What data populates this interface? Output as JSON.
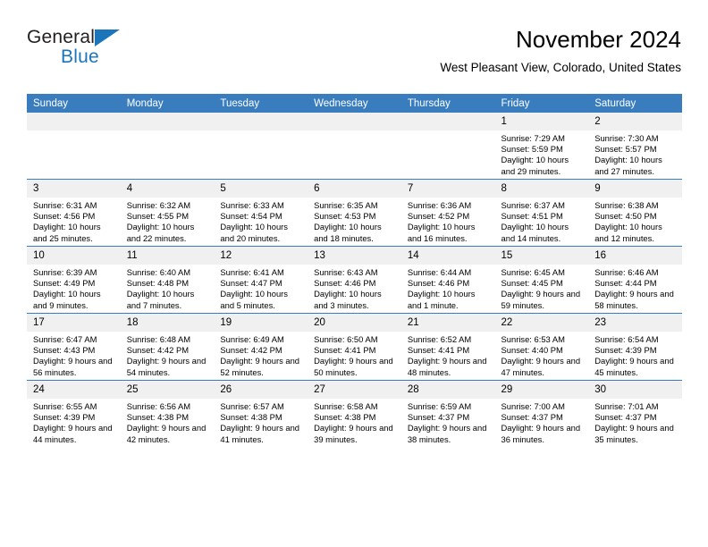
{
  "brand": {
    "name_part1": "General",
    "name_part2": "Blue",
    "triangle_color": "#1b75bb",
    "text_color": "#231f20"
  },
  "header": {
    "title": "November 2024",
    "subtitle": "West Pleasant View, Colorado, United States"
  },
  "theme": {
    "header_blue": "#3a7dbf",
    "daynum_bg": "#f0f0f0",
    "text": "#000000"
  },
  "weekdays": [
    "Sunday",
    "Monday",
    "Tuesday",
    "Wednesday",
    "Thursday",
    "Friday",
    "Saturday"
  ],
  "labels": {
    "sunrise_prefix": "Sunrise:",
    "sunset_prefix": "Sunset:",
    "daylight_prefix": "Daylight:"
  },
  "weeks": [
    [
      {
        "day": "",
        "blank": true,
        "sunrise": "",
        "sunset": "",
        "daylight": ""
      },
      {
        "day": "",
        "blank": true,
        "sunrise": "",
        "sunset": "",
        "daylight": ""
      },
      {
        "day": "",
        "blank": true,
        "sunrise": "",
        "sunset": "",
        "daylight": ""
      },
      {
        "day": "",
        "blank": true,
        "sunrise": "",
        "sunset": "",
        "daylight": ""
      },
      {
        "day": "",
        "blank": true,
        "sunrise": "",
        "sunset": "",
        "daylight": ""
      },
      {
        "day": "1",
        "blank": false,
        "sunrise": "Sunrise: 7:29 AM",
        "sunset": "Sunset: 5:59 PM",
        "daylight": "Daylight: 10 hours and 29 minutes."
      },
      {
        "day": "2",
        "blank": false,
        "sunrise": "Sunrise: 7:30 AM",
        "sunset": "Sunset: 5:57 PM",
        "daylight": "Daylight: 10 hours and 27 minutes."
      }
    ],
    [
      {
        "day": "3",
        "blank": false,
        "sunrise": "Sunrise: 6:31 AM",
        "sunset": "Sunset: 4:56 PM",
        "daylight": "Daylight: 10 hours and 25 minutes."
      },
      {
        "day": "4",
        "blank": false,
        "sunrise": "Sunrise: 6:32 AM",
        "sunset": "Sunset: 4:55 PM",
        "daylight": "Daylight: 10 hours and 22 minutes."
      },
      {
        "day": "5",
        "blank": false,
        "sunrise": "Sunrise: 6:33 AM",
        "sunset": "Sunset: 4:54 PM",
        "daylight": "Daylight: 10 hours and 20 minutes."
      },
      {
        "day": "6",
        "blank": false,
        "sunrise": "Sunrise: 6:35 AM",
        "sunset": "Sunset: 4:53 PM",
        "daylight": "Daylight: 10 hours and 18 minutes."
      },
      {
        "day": "7",
        "blank": false,
        "sunrise": "Sunrise: 6:36 AM",
        "sunset": "Sunset: 4:52 PM",
        "daylight": "Daylight: 10 hours and 16 minutes."
      },
      {
        "day": "8",
        "blank": false,
        "sunrise": "Sunrise: 6:37 AM",
        "sunset": "Sunset: 4:51 PM",
        "daylight": "Daylight: 10 hours and 14 minutes."
      },
      {
        "day": "9",
        "blank": false,
        "sunrise": "Sunrise: 6:38 AM",
        "sunset": "Sunset: 4:50 PM",
        "daylight": "Daylight: 10 hours and 12 minutes."
      }
    ],
    [
      {
        "day": "10",
        "blank": false,
        "sunrise": "Sunrise: 6:39 AM",
        "sunset": "Sunset: 4:49 PM",
        "daylight": "Daylight: 10 hours and 9 minutes."
      },
      {
        "day": "11",
        "blank": false,
        "sunrise": "Sunrise: 6:40 AM",
        "sunset": "Sunset: 4:48 PM",
        "daylight": "Daylight: 10 hours and 7 minutes."
      },
      {
        "day": "12",
        "blank": false,
        "sunrise": "Sunrise: 6:41 AM",
        "sunset": "Sunset: 4:47 PM",
        "daylight": "Daylight: 10 hours and 5 minutes."
      },
      {
        "day": "13",
        "blank": false,
        "sunrise": "Sunrise: 6:43 AM",
        "sunset": "Sunset: 4:46 PM",
        "daylight": "Daylight: 10 hours and 3 minutes."
      },
      {
        "day": "14",
        "blank": false,
        "sunrise": "Sunrise: 6:44 AM",
        "sunset": "Sunset: 4:46 PM",
        "daylight": "Daylight: 10 hours and 1 minute."
      },
      {
        "day": "15",
        "blank": false,
        "sunrise": "Sunrise: 6:45 AM",
        "sunset": "Sunset: 4:45 PM",
        "daylight": "Daylight: 9 hours and 59 minutes."
      },
      {
        "day": "16",
        "blank": false,
        "sunrise": "Sunrise: 6:46 AM",
        "sunset": "Sunset: 4:44 PM",
        "daylight": "Daylight: 9 hours and 58 minutes."
      }
    ],
    [
      {
        "day": "17",
        "blank": false,
        "sunrise": "Sunrise: 6:47 AM",
        "sunset": "Sunset: 4:43 PM",
        "daylight": "Daylight: 9 hours and 56 minutes."
      },
      {
        "day": "18",
        "blank": false,
        "sunrise": "Sunrise: 6:48 AM",
        "sunset": "Sunset: 4:42 PM",
        "daylight": "Daylight: 9 hours and 54 minutes."
      },
      {
        "day": "19",
        "blank": false,
        "sunrise": "Sunrise: 6:49 AM",
        "sunset": "Sunset: 4:42 PM",
        "daylight": "Daylight: 9 hours and 52 minutes."
      },
      {
        "day": "20",
        "blank": false,
        "sunrise": "Sunrise: 6:50 AM",
        "sunset": "Sunset: 4:41 PM",
        "daylight": "Daylight: 9 hours and 50 minutes."
      },
      {
        "day": "21",
        "blank": false,
        "sunrise": "Sunrise: 6:52 AM",
        "sunset": "Sunset: 4:41 PM",
        "daylight": "Daylight: 9 hours and 48 minutes."
      },
      {
        "day": "22",
        "blank": false,
        "sunrise": "Sunrise: 6:53 AM",
        "sunset": "Sunset: 4:40 PM",
        "daylight": "Daylight: 9 hours and 47 minutes."
      },
      {
        "day": "23",
        "blank": false,
        "sunrise": "Sunrise: 6:54 AM",
        "sunset": "Sunset: 4:39 PM",
        "daylight": "Daylight: 9 hours and 45 minutes."
      }
    ],
    [
      {
        "day": "24",
        "blank": false,
        "sunrise": "Sunrise: 6:55 AM",
        "sunset": "Sunset: 4:39 PM",
        "daylight": "Daylight: 9 hours and 44 minutes."
      },
      {
        "day": "25",
        "blank": false,
        "sunrise": "Sunrise: 6:56 AM",
        "sunset": "Sunset: 4:38 PM",
        "daylight": "Daylight: 9 hours and 42 minutes."
      },
      {
        "day": "26",
        "blank": false,
        "sunrise": "Sunrise: 6:57 AM",
        "sunset": "Sunset: 4:38 PM",
        "daylight": "Daylight: 9 hours and 41 minutes."
      },
      {
        "day": "27",
        "blank": false,
        "sunrise": "Sunrise: 6:58 AM",
        "sunset": "Sunset: 4:38 PM",
        "daylight": "Daylight: 9 hours and 39 minutes."
      },
      {
        "day": "28",
        "blank": false,
        "sunrise": "Sunrise: 6:59 AM",
        "sunset": "Sunset: 4:37 PM",
        "daylight": "Daylight: 9 hours and 38 minutes."
      },
      {
        "day": "29",
        "blank": false,
        "sunrise": "Sunrise: 7:00 AM",
        "sunset": "Sunset: 4:37 PM",
        "daylight": "Daylight: 9 hours and 36 minutes."
      },
      {
        "day": "30",
        "blank": false,
        "sunrise": "Sunrise: 7:01 AM",
        "sunset": "Sunset: 4:37 PM",
        "daylight": "Daylight: 9 hours and 35 minutes."
      }
    ]
  ]
}
